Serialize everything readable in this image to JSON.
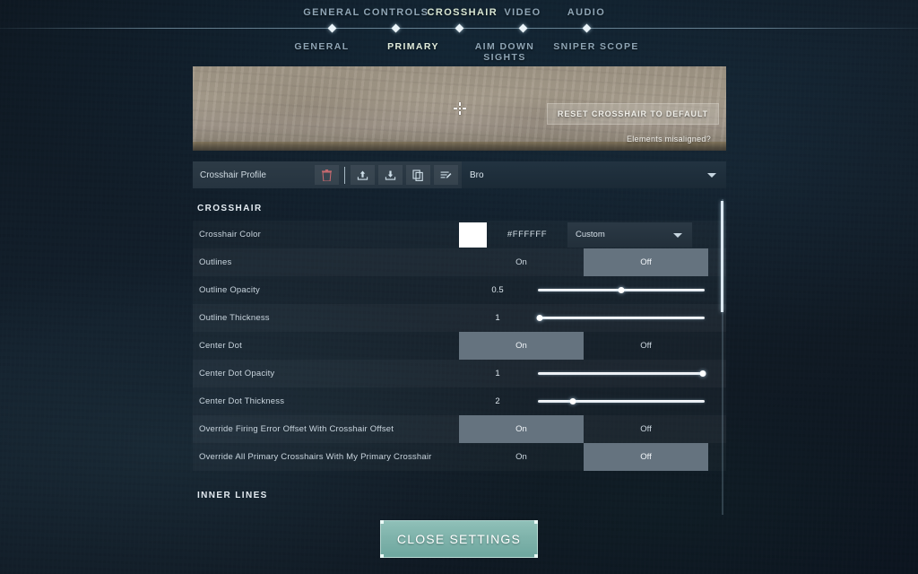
{
  "nav": {
    "primary": [
      {
        "label": "GENERAL",
        "active": false
      },
      {
        "label": "CONTROLS",
        "active": false
      },
      {
        "label": "CROSSHAIR",
        "active": true
      },
      {
        "label": "VIDEO",
        "active": false
      },
      {
        "label": "AUDIO",
        "active": false
      }
    ],
    "secondary": [
      {
        "label": "GENERAL",
        "active": false
      },
      {
        "label": "PRIMARY",
        "active": true
      },
      {
        "label": "AIM DOWN SIGHTS",
        "active": false
      },
      {
        "label": "SNIPER SCOPE",
        "active": false
      }
    ]
  },
  "preview": {
    "reset_label": "RESET CROSSHAIR TO DEFAULT",
    "misaligned_label": "Elements misaligned?"
  },
  "profile": {
    "label": "Crosshair Profile",
    "value": "Bro",
    "icons": [
      "delete-icon",
      "import-icon",
      "export-icon",
      "duplicate-icon",
      "edit-icon"
    ]
  },
  "sections": {
    "crosshair_header": "CROSSHAIR",
    "inner_lines_header": "INNER LINES"
  },
  "rows": [
    {
      "label": "Crosshair Color",
      "type": "color",
      "hex": "#FFFFFF",
      "swatch": "#FFFFFF",
      "preset": "Custom"
    },
    {
      "label": "Outlines",
      "type": "toggle",
      "on": "On",
      "off": "Off",
      "selected": "Off"
    },
    {
      "label": "Outline Opacity",
      "type": "slider",
      "value": "0.5",
      "percent": 50
    },
    {
      "label": "Outline Thickness",
      "type": "slider",
      "value": "1",
      "percent": 1
    },
    {
      "label": "Center Dot",
      "type": "toggle",
      "on": "On",
      "off": "Off",
      "selected": "On"
    },
    {
      "label": "Center Dot Opacity",
      "type": "slider",
      "value": "1",
      "percent": 99
    },
    {
      "label": "Center Dot Thickness",
      "type": "slider",
      "value": "2",
      "percent": 21
    },
    {
      "label": "Override Firing Error Offset With Crosshair Offset",
      "type": "toggle",
      "on": "On",
      "off": "Off",
      "selected": "On"
    },
    {
      "label": "Override All Primary Crosshairs With My Primary Crosshair",
      "type": "toggle",
      "on": "On",
      "off": "Off",
      "selected": "Off"
    }
  ],
  "footer": {
    "close_label": "CLOSE SETTINGS"
  },
  "colors": {
    "accent_teal": "#7fb3ab",
    "active_tab": "#d8e6d3",
    "toggle_selected": "#65737f",
    "background": "#101a25"
  }
}
